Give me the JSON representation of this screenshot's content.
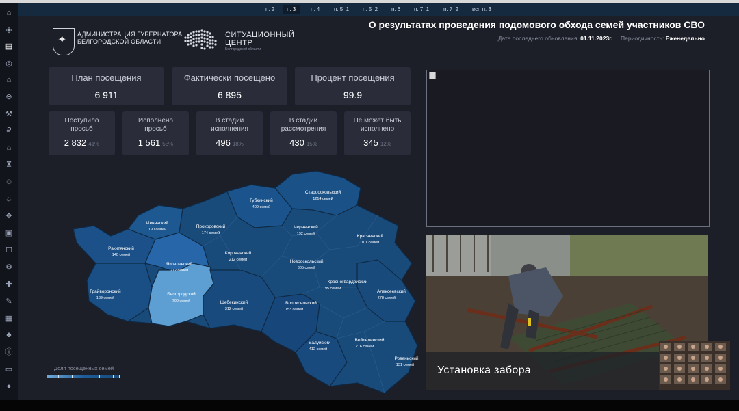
{
  "tabs": [
    {
      "label": "п. 2",
      "active": false
    },
    {
      "label": "п. 3",
      "active": true
    },
    {
      "label": "п. 4",
      "active": false
    },
    {
      "label": "п. 5_1",
      "active": false
    },
    {
      "label": "п. 5_2",
      "active": false
    },
    {
      "label": "п. 6",
      "active": false
    },
    {
      "label": "п. 7_1",
      "active": false
    },
    {
      "label": "п. 7_2",
      "active": false
    },
    {
      "label": "всп п. 3",
      "active": false
    }
  ],
  "header": {
    "admin_line1": "АДМИНИСТРАЦИЯ ГУБЕРНАТОРА",
    "admin_line2": "БЕЛГОРОДСКОЙ ОБЛАСТИ",
    "sc_line1": "СИТУАЦИОННЫЙ",
    "sc_line2": "ЦЕНТР",
    "sc_sub": "Белгородской области",
    "title": "О результатах проведения подомового обхода семей участников СВО",
    "updated_label": "Дата последнего обновления:",
    "updated_value": "01.11.2023г.",
    "period_label": "Периодичность:",
    "period_value": "Еженедельно"
  },
  "kpis": [
    {
      "label": "План посещения",
      "value": "6 911"
    },
    {
      "label": "Фактически посещено",
      "value": "6 895"
    },
    {
      "label": "Процент посещения",
      "value": "99.9"
    }
  ],
  "requests": [
    {
      "line1": "Поступило",
      "line2": "просьб",
      "value": "2 832",
      "pct": "41%"
    },
    {
      "line1": "Исполнено",
      "line2": "просьб",
      "value": "1 561",
      "pct": "55%"
    },
    {
      "line1": "В стадии",
      "line2": "исполнения",
      "value": "496",
      "pct": "18%"
    },
    {
      "line1": "В стадии",
      "line2": "рассмотрения",
      "value": "430",
      "pct": "15%"
    },
    {
      "line1": "Не может быть",
      "line2": "исполнено",
      "value": "345",
      "pct": "12%"
    }
  ],
  "districts": [
    {
      "name": "Губкинский",
      "value": "409 семей"
    },
    {
      "name": "Старооскольский",
      "value": "1214 семей"
    },
    {
      "name": "Ивнянский",
      "value": "190 семей"
    },
    {
      "name": "Прохоровский",
      "value": "174 семей"
    },
    {
      "name": "Чернянский",
      "value": "192 семей"
    },
    {
      "name": "Красненский",
      "value": "101 семей"
    },
    {
      "name": "Ракитянский",
      "value": "140 семей"
    },
    {
      "name": "Корочанский",
      "value": "212 семей"
    },
    {
      "name": "Яковлевский",
      "value": "272 семей"
    },
    {
      "name": "Новооскольский",
      "value": "305 семей"
    },
    {
      "name": "Грайворонский",
      "value": "139 семей"
    },
    {
      "name": "Белгородский",
      "value": "700 семей"
    },
    {
      "name": "Красногвардейский",
      "value": "195 семей"
    },
    {
      "name": "Алексеевский",
      "value": "278 семей"
    },
    {
      "name": "Шебекинский",
      "value": "312 семей"
    },
    {
      "name": "Волоконовский",
      "value": "153 семей"
    },
    {
      "name": "Валуйский",
      "value": "412 семей"
    },
    {
      "name": "Вейделевский",
      "value": "216 семей"
    },
    {
      "name": "Ровеньский",
      "value": "131 семей"
    }
  ],
  "legend": {
    "label": "Доля посещенных семей"
  },
  "photo": {
    "caption": "Установка забора"
  },
  "colors": {
    "tab_bar": "#15293f",
    "card": "#2a2d39",
    "map_base": "#184a7a",
    "map_light": "#5e9fd3",
    "background": "#1c1e28"
  },
  "icons": [
    "home-icon",
    "shield-icon",
    "chart-icon",
    "target-icon",
    "education-icon",
    "car-icon",
    "sport-icon",
    "ruble-icon",
    "house-icon",
    "building-icon",
    "people-icon",
    "family-icon",
    "hands-icon",
    "basket-icon",
    "vote-icon",
    "settings-icon",
    "medical-icon",
    "doc-icon",
    "tree-icon",
    "info-icon",
    "print-icon",
    "ball-icon"
  ]
}
